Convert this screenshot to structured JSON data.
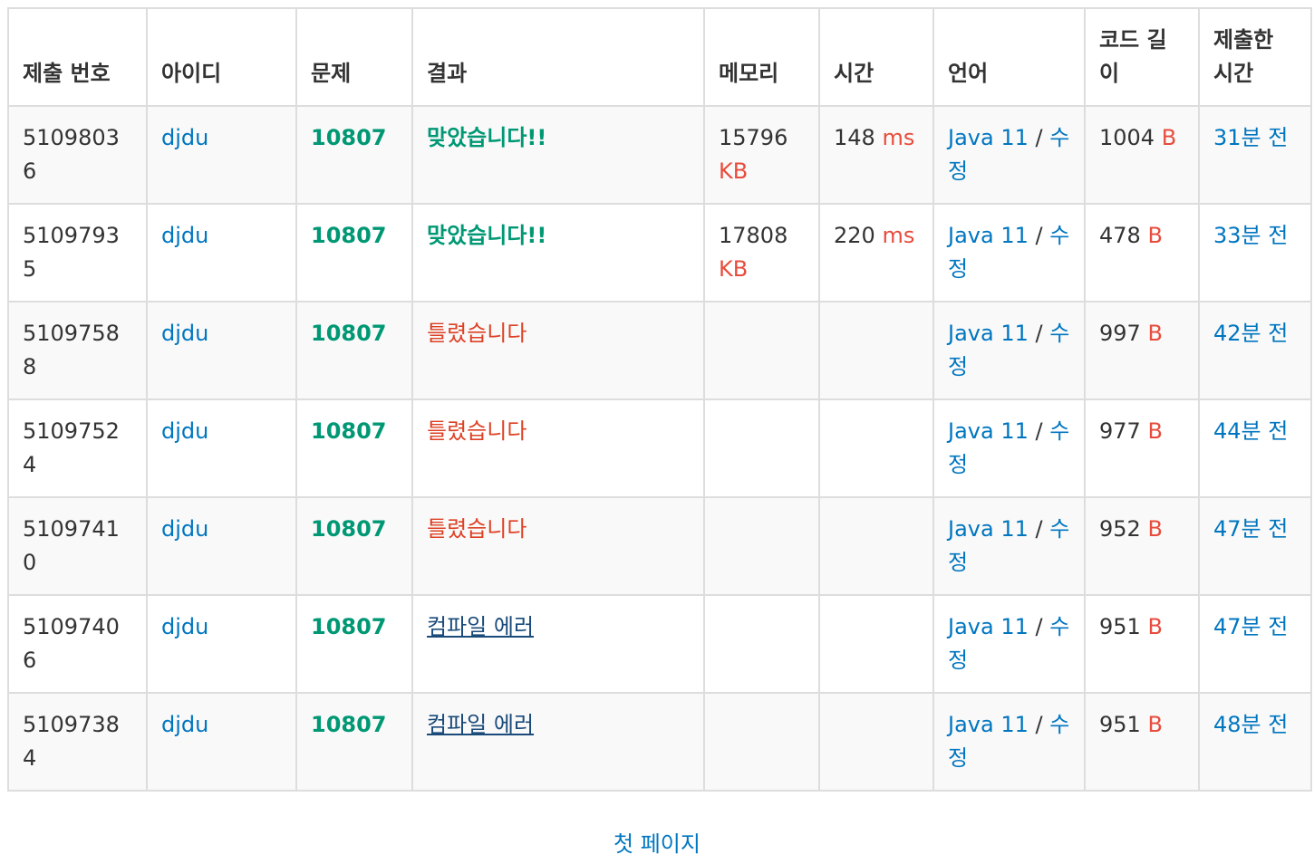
{
  "columns": [
    "제출 번호",
    "아이디",
    "문제",
    "결과",
    "메모리",
    "시간",
    "언어",
    "코드 길이",
    "제출한 시간"
  ],
  "rows": [
    {
      "id": "51098036",
      "user": "djdu",
      "problem": "10807",
      "result": "맞았습니다!!",
      "result_type": "ac",
      "memory": "15796",
      "memory_unit": "KB",
      "time": "148",
      "time_unit": "ms",
      "lang": "Java 11",
      "lang_sep": "/",
      "edit": "수정",
      "code_len": "1004",
      "code_unit": "B",
      "submitted": "31분 전"
    },
    {
      "id": "51097935",
      "user": "djdu",
      "problem": "10807",
      "result": "맞았습니다!!",
      "result_type": "ac",
      "memory": "17808",
      "memory_unit": "KB",
      "time": "220",
      "time_unit": "ms",
      "lang": "Java 11",
      "lang_sep": "/",
      "edit": "수정",
      "code_len": "478",
      "code_unit": "B",
      "submitted": "33분 전"
    },
    {
      "id": "51097588",
      "user": "djdu",
      "problem": "10807",
      "result": "틀렸습니다",
      "result_type": "wa",
      "memory": "",
      "memory_unit": "",
      "time": "",
      "time_unit": "",
      "lang": "Java 11",
      "lang_sep": "/",
      "edit": "수정",
      "code_len": "997",
      "code_unit": "B",
      "submitted": "42분 전"
    },
    {
      "id": "51097524",
      "user": "djdu",
      "problem": "10807",
      "result": "틀렸습니다",
      "result_type": "wa",
      "memory": "",
      "memory_unit": "",
      "time": "",
      "time_unit": "",
      "lang": "Java 11",
      "lang_sep": "/",
      "edit": "수정",
      "code_len": "977",
      "code_unit": "B",
      "submitted": "44분 전"
    },
    {
      "id": "51097410",
      "user": "djdu",
      "problem": "10807",
      "result": "틀렸습니다",
      "result_type": "wa",
      "memory": "",
      "memory_unit": "",
      "time": "",
      "time_unit": "",
      "lang": "Java 11",
      "lang_sep": "/",
      "edit": "수정",
      "code_len": "952",
      "code_unit": "B",
      "submitted": "47분 전"
    },
    {
      "id": "51097406",
      "user": "djdu",
      "problem": "10807",
      "result": "컴파일 에러",
      "result_type": "ce",
      "memory": "",
      "memory_unit": "",
      "time": "",
      "time_unit": "",
      "lang": "Java 11",
      "lang_sep": "/",
      "edit": "수정",
      "code_len": "951",
      "code_unit": "B",
      "submitted": "47분 전"
    },
    {
      "id": "51097384",
      "user": "djdu",
      "problem": "10807",
      "result": "컴파일 에러",
      "result_type": "ce",
      "memory": "",
      "memory_unit": "",
      "time": "",
      "time_unit": "",
      "lang": "Java 11",
      "lang_sep": "/",
      "edit": "수정",
      "code_len": "951",
      "code_unit": "B",
      "submitted": "48분 전"
    }
  ],
  "pager": {
    "first_page": "첫 페이지"
  },
  "colors": {
    "link": "#0076c0",
    "accepted": "#009874",
    "wrong": "#dd4124",
    "unit": "#e74c3c",
    "compile_error": "#1a4b7a"
  }
}
